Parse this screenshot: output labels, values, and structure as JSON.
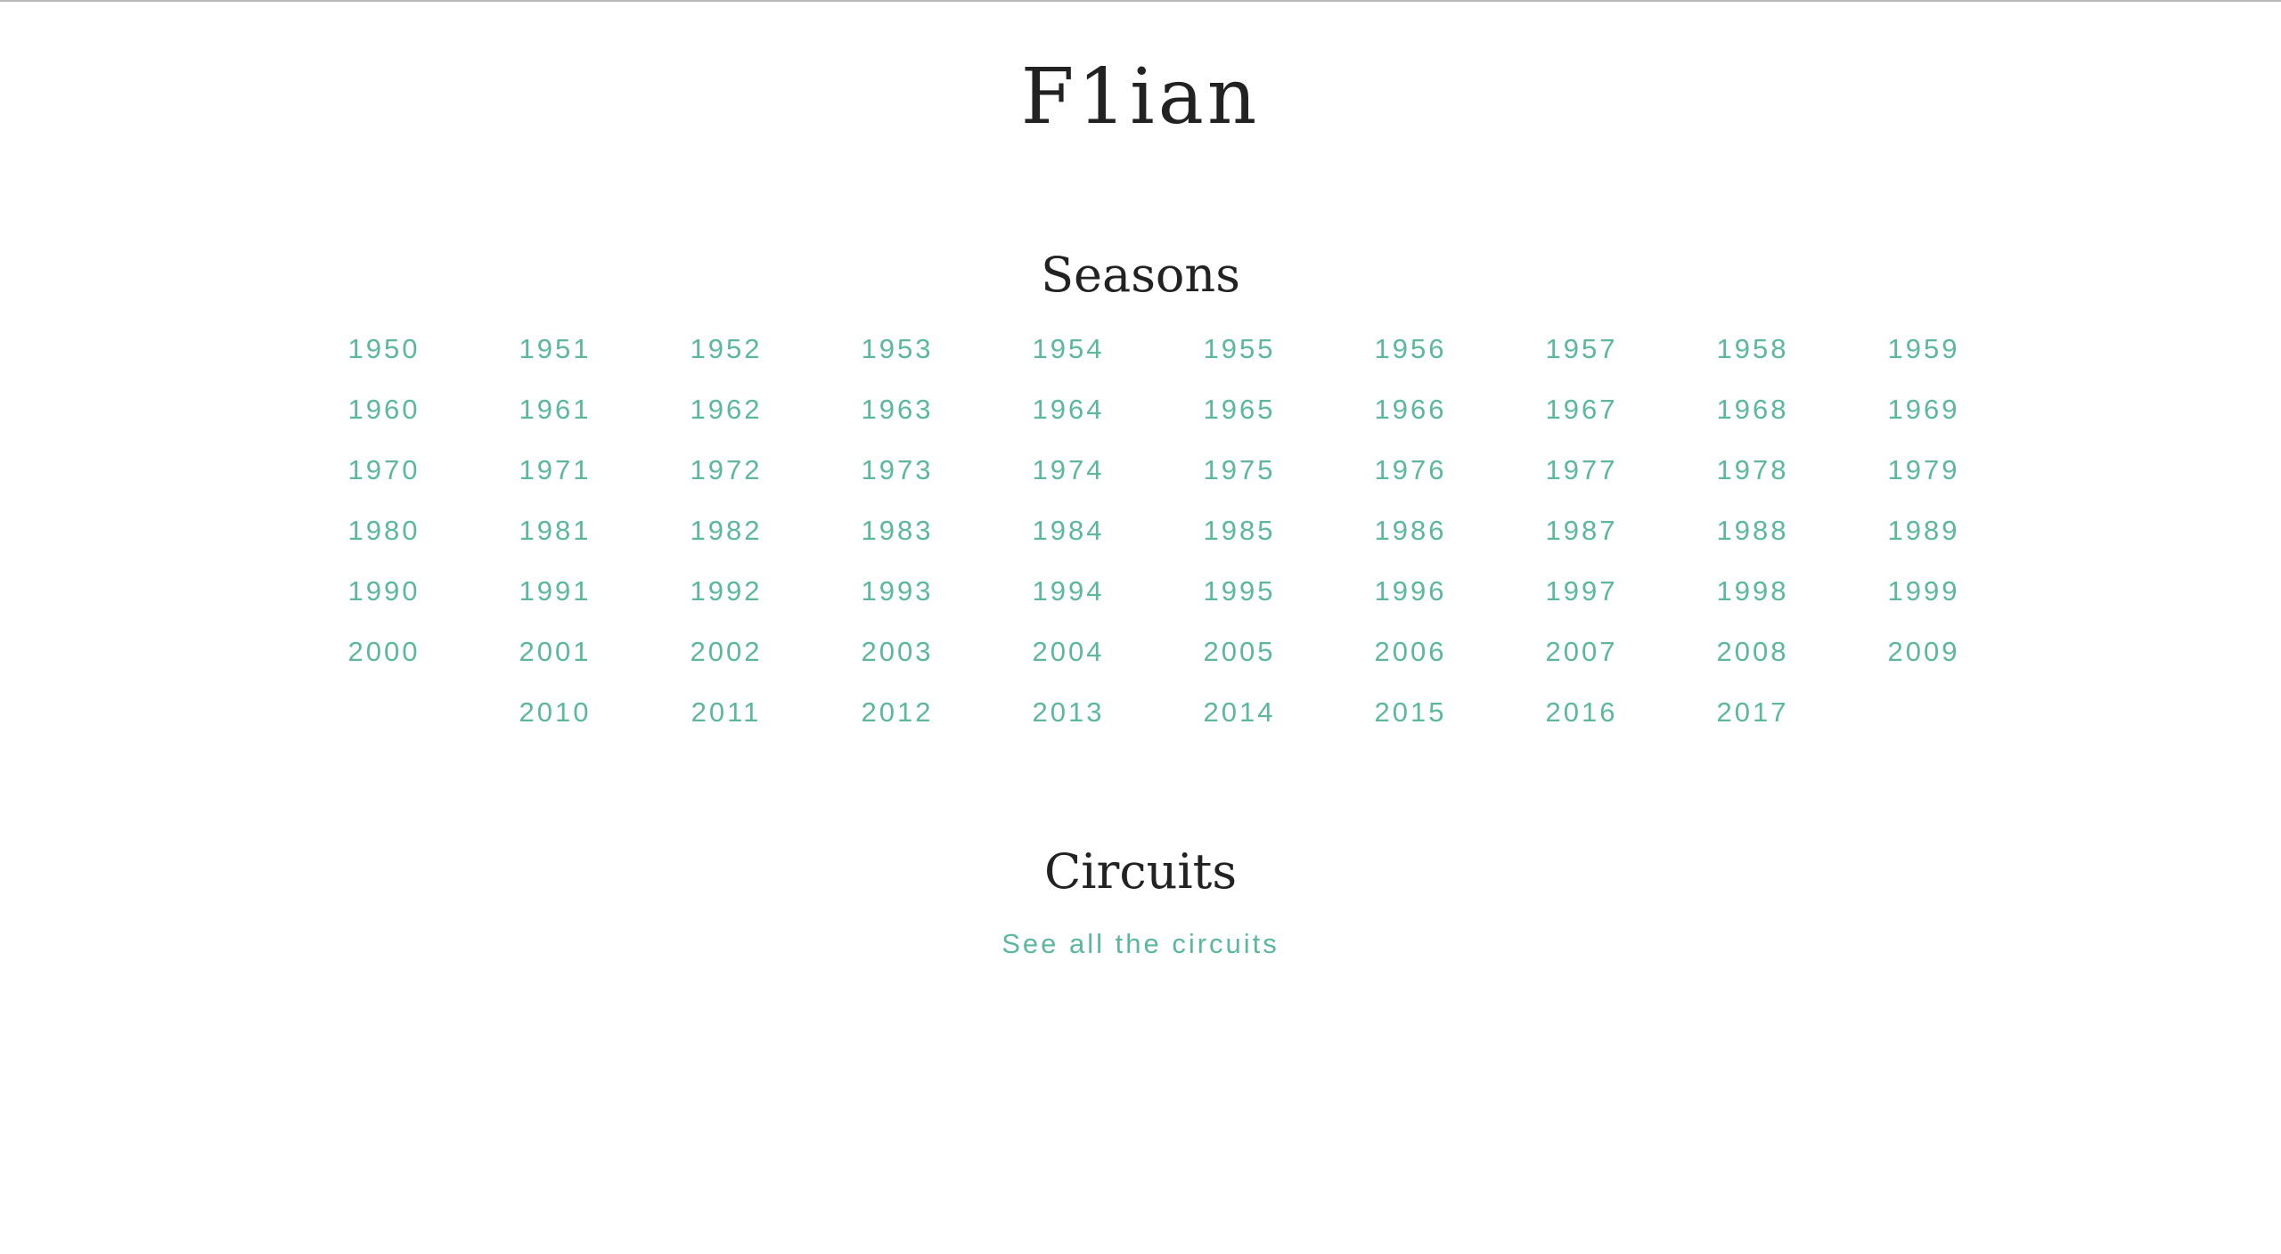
{
  "site": {
    "title": "F1ian"
  },
  "seasons": {
    "heading": "Seasons",
    "years": [
      "1950",
      "1951",
      "1952",
      "1953",
      "1954",
      "1955",
      "1956",
      "1957",
      "1958",
      "1959",
      "1960",
      "1961",
      "1962",
      "1963",
      "1964",
      "1965",
      "1966",
      "1967",
      "1968",
      "1969",
      "1970",
      "1971",
      "1972",
      "1973",
      "1974",
      "1975",
      "1976",
      "1977",
      "1978",
      "1979",
      "1980",
      "1981",
      "1982",
      "1983",
      "1984",
      "1985",
      "1986",
      "1987",
      "1988",
      "1989",
      "1990",
      "1991",
      "1992",
      "1993",
      "1994",
      "1995",
      "1996",
      "1997",
      "1998",
      "1999",
      "2000",
      "2001",
      "2002",
      "2003",
      "2004",
      "2005",
      "2006",
      "2007",
      "2008",
      "2009",
      "2010",
      "2011",
      "2012",
      "2013",
      "2014",
      "2015",
      "2016",
      "2017"
    ]
  },
  "circuits": {
    "heading": "Circuits",
    "link_label": "See all the circuits"
  },
  "colors": {
    "link": "#5bb89d",
    "heading": "#222222",
    "background": "#ffffff"
  }
}
